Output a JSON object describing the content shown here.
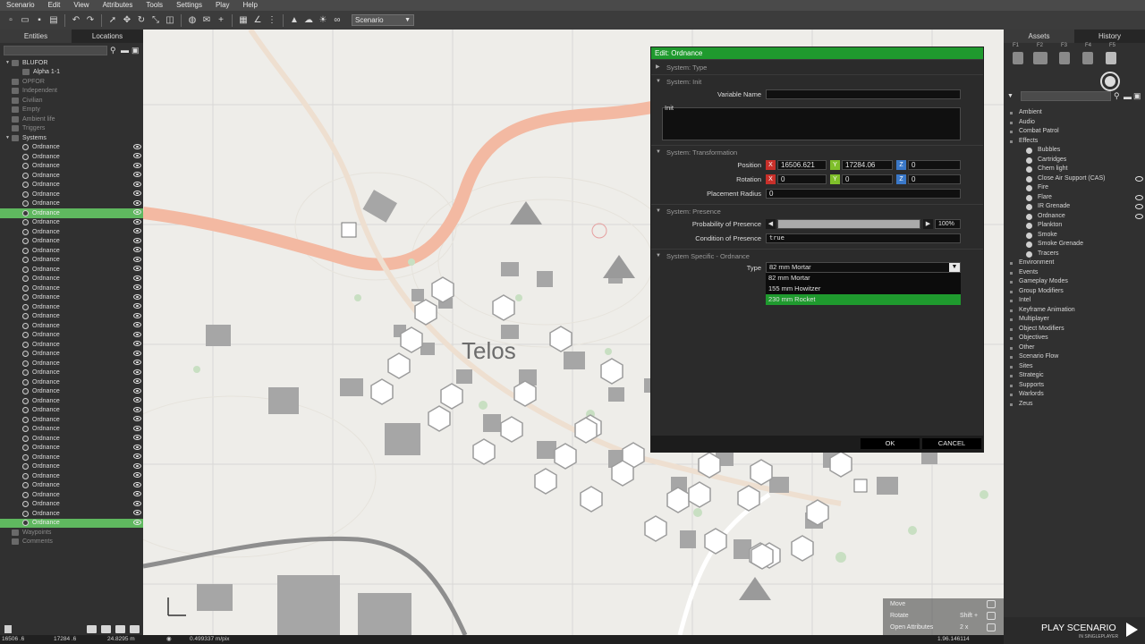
{
  "menubar": [
    "Scenario",
    "Edit",
    "View",
    "Attributes",
    "Tools",
    "Settings",
    "Play",
    "Help"
  ],
  "toolbar": {
    "scenario_select": "Scenario"
  },
  "left_panel": {
    "tabs": [
      "Entities",
      "Locations"
    ],
    "tree": [
      {
        "label": "BLUFOR",
        "level": 0,
        "dim": false
      },
      {
        "label": "Alpha 1-1",
        "level": 1,
        "dim": false
      },
      {
        "label": "OPFOR",
        "level": 0,
        "dim": true
      },
      {
        "label": "Independent",
        "level": 0,
        "dim": true
      },
      {
        "label": "Civilian",
        "level": 0,
        "dim": true
      },
      {
        "label": "Empty",
        "level": 0,
        "dim": true
      },
      {
        "label": "Ambient life",
        "level": 0,
        "dim": true
      },
      {
        "label": "Triggers",
        "level": 0,
        "dim": true
      },
      {
        "label": "Systems",
        "level": 0,
        "dim": false
      }
    ],
    "ordnance_label": "Ordnance",
    "ordnance_count": 41,
    "selected_indices": [
      7,
      40
    ],
    "tail": [
      {
        "label": "Waypoints",
        "dim": true
      },
      {
        "label": "Comments",
        "dim": true
      }
    ]
  },
  "map": {
    "town_label": "Telos"
  },
  "dialog": {
    "title": "Edit: Ordnance",
    "sections": {
      "type": "System: Type",
      "init": "System: Init",
      "transformation": "System: Transformation",
      "presence": "System: Presence",
      "specific": "System Specific - Ordnance"
    },
    "variable_name_label": "Variable Name",
    "variable_name_value": "",
    "init_label": "Init",
    "position_label": "Position",
    "position": {
      "x": "16506.621",
      "y": "17284.06",
      "z": "0"
    },
    "rotation_label": "Rotation",
    "rotation": {
      "x": "0",
      "y": "0",
      "z": "0"
    },
    "placement_radius_label": "Placement Radius",
    "placement_radius": "0",
    "probability_label": "Probability of Presence",
    "probability_value": "100%",
    "probability_fraction": 1.0,
    "condition_label": "Condition of Presence",
    "condition_value": "true",
    "type_label": "Type",
    "type_selected": "82 mm Mortar",
    "type_options": [
      "82 mm Mortar",
      "155 mm Howitzer",
      "230 mm Rocket"
    ],
    "type_highlight_index": 2,
    "ok": "OK",
    "cancel": "CANCEL"
  },
  "right_panel": {
    "tabs": [
      "Assets",
      "History"
    ],
    "fkeys": [
      "F1",
      "F2",
      "F3",
      "F4",
      "F5"
    ],
    "items": [
      {
        "label": "Ambient",
        "level": 0
      },
      {
        "label": "Audio",
        "level": 0
      },
      {
        "label": "Combat Patrol",
        "level": 0
      },
      {
        "label": "Effects",
        "level": 0
      },
      {
        "label": "Bubbles",
        "level": 1,
        "eye": false
      },
      {
        "label": "Cartridges",
        "level": 1,
        "eye": false
      },
      {
        "label": "Chem light",
        "level": 1,
        "eye": false
      },
      {
        "label": "Close Air Support (CAS)",
        "level": 1,
        "eye": true
      },
      {
        "label": "Fire",
        "level": 1,
        "eye": false
      },
      {
        "label": "Flare",
        "level": 1,
        "eye": true
      },
      {
        "label": "IR Grenade",
        "level": 1,
        "eye": true
      },
      {
        "label": "Ordnance",
        "level": 1,
        "eye": true
      },
      {
        "label": "Plankton",
        "level": 1,
        "eye": false
      },
      {
        "label": "Smoke",
        "level": 1,
        "eye": false
      },
      {
        "label": "Smoke Grenade",
        "level": 1,
        "eye": false
      },
      {
        "label": "Tracers",
        "level": 1,
        "eye": false
      },
      {
        "label": "Environment",
        "level": 0
      },
      {
        "label": "Events",
        "level": 0
      },
      {
        "label": "Gameplay Modes",
        "level": 0
      },
      {
        "label": "Group Modifiers",
        "level": 0
      },
      {
        "label": "Intel",
        "level": 0
      },
      {
        "label": "Keyframe Animation",
        "level": 0
      },
      {
        "label": "Multiplayer",
        "level": 0
      },
      {
        "label": "Object Modifiers",
        "level": 0
      },
      {
        "label": "Objectives",
        "level": 0
      },
      {
        "label": "Other",
        "level": 0
      },
      {
        "label": "Scenario Flow",
        "level": 0
      },
      {
        "label": "Sites",
        "level": 0
      },
      {
        "label": "Strategic",
        "level": 0
      },
      {
        "label": "Supports",
        "level": 0
      },
      {
        "label": "Warlords",
        "level": 0
      },
      {
        "label": "Zeus",
        "level": 0
      }
    ]
  },
  "play": {
    "label": "PLAY SCENARIO",
    "sub": "IN SINGLEPLAYER"
  },
  "hints": [
    {
      "label": "Move",
      "key": ""
    },
    {
      "label": "Rotate",
      "key": "Shift +"
    },
    {
      "label": "Open Attributes",
      "key": "2 x"
    }
  ],
  "statusbar": {
    "x": "16506 .6",
    "y": "17284 .6",
    "z": "24.8295 m",
    "scale": "0.499337 m/pix",
    "version": "1.96.146114"
  },
  "colors": {
    "accent": "#1f9a2e",
    "selection": "#5fb85f",
    "axis_x": "#c8302a",
    "axis_y": "#7fbf2a",
    "axis_z": "#3a78c8"
  }
}
